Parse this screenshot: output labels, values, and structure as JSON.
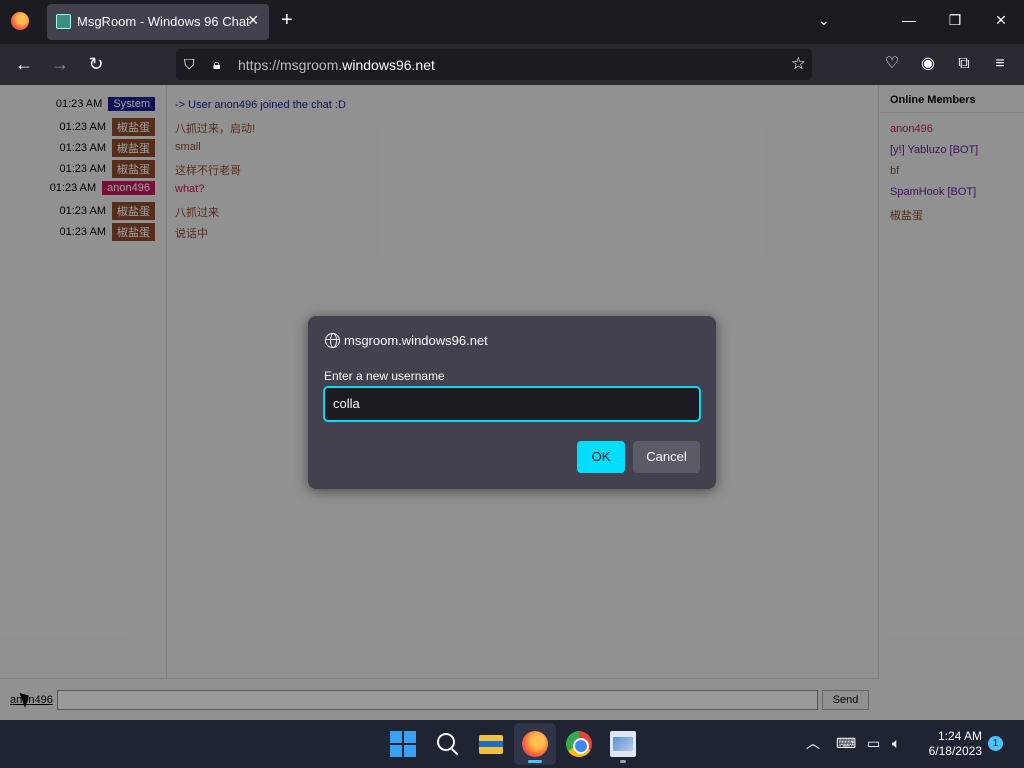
{
  "browser": {
    "tab_title": "MsgRoom - Windows 96 Chat",
    "tab_close": "✕",
    "new_tab": "+",
    "tab_list": "⌄",
    "window_controls": {
      "minimize": "—",
      "maximize": "❐",
      "close": "✕"
    },
    "url_prefix": "https://msgroom.",
    "url_host": "windows96.net"
  },
  "chat": {
    "messages": [
      {
        "time": "01:23 AM",
        "user": "System",
        "badge_color": "#1a1a8c",
        "text": "-> User anon496 joined the chat :D",
        "text_color": "#1a1a8c"
      },
      {
        "time": "01:23 AM",
        "user": "椒盐蛋",
        "badge_color": "#8b4a2b",
        "text": "八抓过来，启动!",
        "text_color": "#8b4a2b"
      },
      {
        "time": "01:23 AM",
        "user": "椒盐蛋",
        "badge_color": "#8b4a2b",
        "text": "small",
        "text_color": "#8b4a2b"
      },
      {
        "time": "01:23 AM",
        "user": "椒盐蛋",
        "badge_color": "#8b4a2b",
        "text": "这样不行老哥",
        "text_color": "#8b4a2b"
      },
      {
        "time": "01:23 AM",
        "user": "anon496",
        "badge_color": "#c2185b",
        "text": "what?",
        "text_color": "#c2185b"
      },
      {
        "time": "01:23 AM",
        "user": "椒盐蛋",
        "badge_color": "#8b4a2b",
        "text": "八抓过来",
        "text_color": "#8b4a2b"
      },
      {
        "time": "01:23 AM",
        "user": "椒盐蛋",
        "badge_color": "#8b4a2b",
        "text": "说话中",
        "text_color": "#8b4a2b"
      }
    ]
  },
  "members": {
    "title": "Online Members",
    "list": [
      {
        "name": "anon496",
        "color": "#c2185b"
      },
      {
        "name": "[y!] Yabluzo [BOT]",
        "color": "#6a1b9a"
      },
      {
        "name": "bf",
        "color": "#8b4a2b"
      },
      {
        "name": "SpamHook [BOT]",
        "color": "#6a1b9a"
      },
      {
        "name": "椒盐蛋",
        "color": "#8b4a2b"
      }
    ]
  },
  "composer": {
    "username": "anon496",
    "send_label": "Send"
  },
  "dialog": {
    "origin": "msgroom.windows96.net",
    "label": "Enter a new username",
    "value": "colla",
    "ok_label": "OK",
    "cancel_label": "Cancel"
  },
  "taskbar": {
    "time": "1:24 AM",
    "date": "6/18/2023",
    "notification_count": "1"
  },
  "colors": {
    "accent": "#00ddff",
    "browser_bg": "#1c1b22",
    "taskbar_bg": "#1f2433"
  }
}
